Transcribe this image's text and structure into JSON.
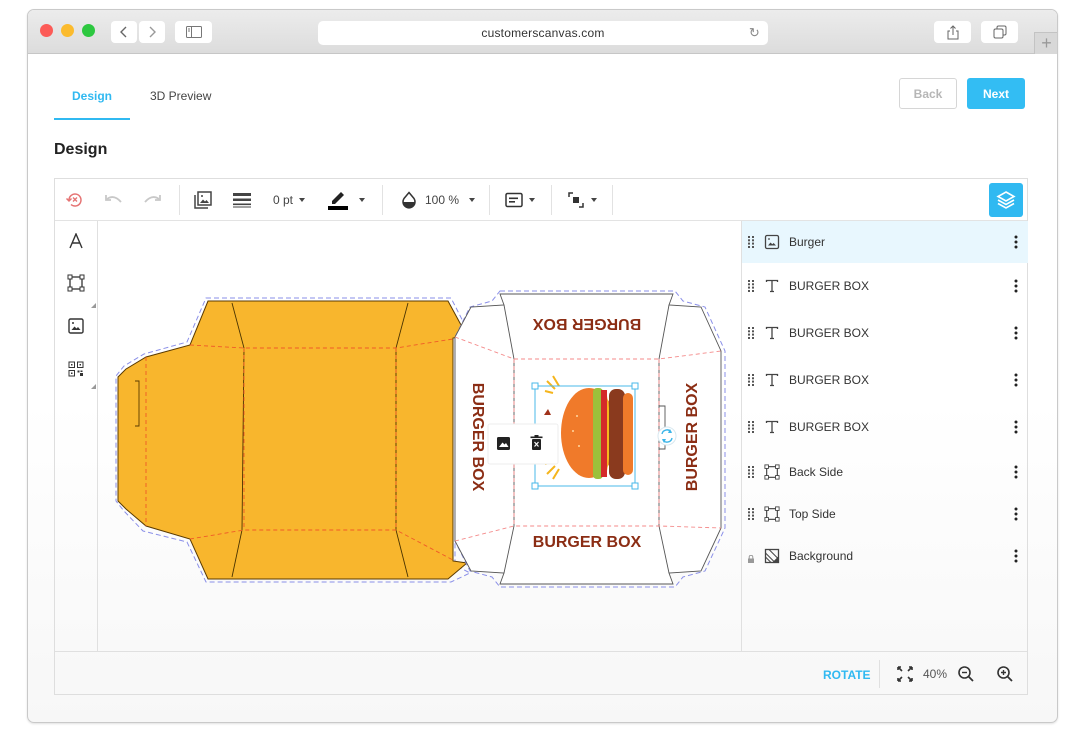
{
  "browser": {
    "url": "customerscanvas.com",
    "icons": [
      "back-icon",
      "forward-icon",
      "sidebar-icon",
      "reload-icon",
      "share-icon",
      "tabs-icon",
      "new-tab-icon"
    ]
  },
  "tabs": [
    {
      "label": "Design",
      "active": true
    },
    {
      "label": "3D Preview",
      "active": false
    }
  ],
  "nav": {
    "back_label": "Back",
    "next_label": "Next"
  },
  "page_title": "Design",
  "toolbar": {
    "stroke_width": "0 pt",
    "opacity": "100 %",
    "stroke_color": "#000000",
    "accent": "#30b9f1"
  },
  "left_tools": [
    {
      "name": "text-tool",
      "icon": "text-icon"
    },
    {
      "name": "shape-tool",
      "icon": "shape-icon"
    },
    {
      "name": "image-tool",
      "icon": "image-icon"
    },
    {
      "name": "qr-tool",
      "icon": "qr-code-icon"
    }
  ],
  "canvas": {
    "panel_texts": {
      "top": "BURGER BOX",
      "left": "BURGER BOX",
      "right": "BURGER BOX",
      "bottom": "BURGER BOX"
    },
    "box_fill": "#f8b62d",
    "text_color": "#8b2d14",
    "selected_element": "Burger",
    "context_menu": [
      "replace-image",
      "delete"
    ]
  },
  "layers": [
    {
      "name": "Burger",
      "type": "image",
      "selected": true,
      "locked": false
    },
    {
      "name": "BURGER BOX",
      "type": "text",
      "selected": false,
      "locked": false
    },
    {
      "name": "BURGER BOX",
      "type": "text",
      "selected": false,
      "locked": false
    },
    {
      "name": "BURGER BOX",
      "type": "text",
      "selected": false,
      "locked": false
    },
    {
      "name": "BURGER BOX",
      "type": "text",
      "selected": false,
      "locked": false
    },
    {
      "name": "Back Side",
      "type": "shape",
      "selected": false,
      "locked": false
    },
    {
      "name": "Top Side",
      "type": "shape",
      "selected": false,
      "locked": false
    },
    {
      "name": "Background",
      "type": "background",
      "selected": false,
      "locked": true
    }
  ],
  "bottom": {
    "rotate_label": "ROTATE",
    "zoom": "40%"
  }
}
